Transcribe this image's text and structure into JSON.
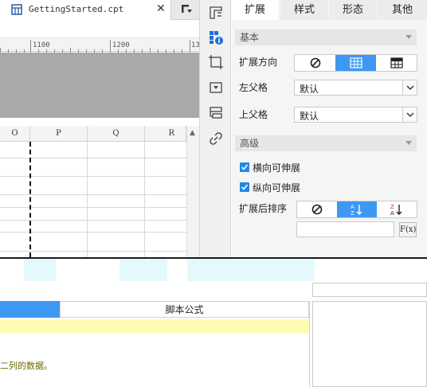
{
  "editor_tab": {
    "title": "GettingStarted.cpt",
    "close_glyph": "✕",
    "file_icon": "report-file-icon",
    "menu_icon": "tab-menu-icon"
  },
  "ruler": {
    "labels": [
      "1100",
      "1200",
      "13"
    ]
  },
  "grid": {
    "columns": [
      "O",
      "P",
      "Q",
      "R"
    ]
  },
  "icon_bar": [
    "cell-element-icon",
    "cell-attribute-icon",
    "cell-style-icon",
    "filter-icon",
    "widget-icon",
    "hyperlink-icon"
  ],
  "panel": {
    "tabs": [
      "扩展",
      "样式",
      "形态",
      "其他"
    ],
    "active_tab": "扩展",
    "basic_section": "基本",
    "expand_direction_label": "扩展方向",
    "left_parent_label": "左父格",
    "left_parent_value": "默认",
    "top_parent_label": "上父格",
    "top_parent_value": "默认",
    "advanced_section": "高级",
    "horizontal_expand_label": "横向可伸展",
    "horizontal_expand_checked": true,
    "vertical_expand_label": "纵向可伸展",
    "vertical_expand_checked": true,
    "sort_after_expand_label": "扩展后排序",
    "sort_formula_value": "",
    "fx_label": "F(x)",
    "accent_color": "#3e98f3"
  },
  "bottom": {
    "script_formula_tab": "脚本公式",
    "hint_text": "二列的数据。"
  }
}
